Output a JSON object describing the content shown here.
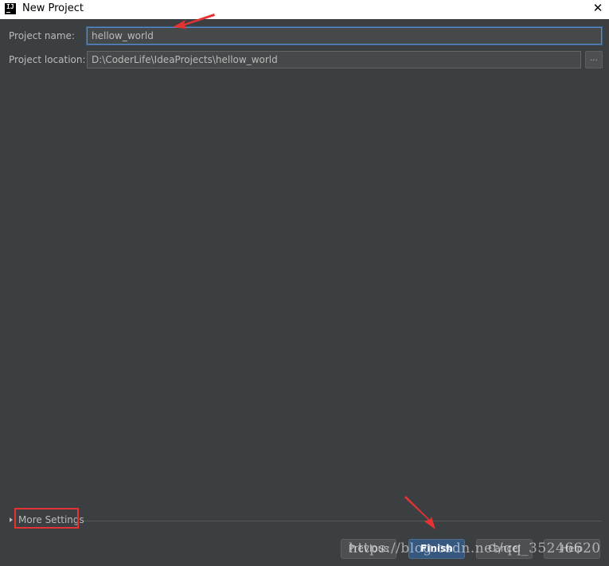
{
  "window": {
    "title": "New Project",
    "logo_text": "IJ",
    "close_symbol": "✕"
  },
  "form": {
    "name_label": "Project name:",
    "name_value": "hellow_world",
    "location_label": "Project location:",
    "location_value": "D:\\CoderLife\\IdeaProjects\\hellow_world",
    "browse_label": "..."
  },
  "more_settings": {
    "label": "More Settings"
  },
  "buttons": {
    "previous": "Previous",
    "finish": "Finish",
    "cancel": "Cancel",
    "help": "Help"
  },
  "watermark": "https://blog.csdn.net/qq_35246620",
  "colors": {
    "background": "#3c3f41",
    "title_bar": "#ffffff",
    "annotation_red": "#e53333",
    "finish_button": "#365880",
    "focus_border": "#5a8bd0"
  },
  "icons": [
    "intellij-logo-icon",
    "close-icon",
    "expand-triangle-icon",
    "annotation-arrow-icon"
  ]
}
